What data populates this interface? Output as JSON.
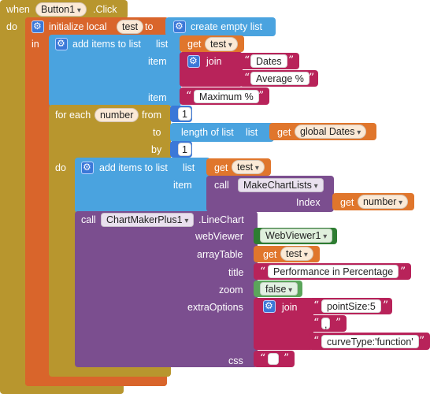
{
  "event": {
    "when": "when",
    "component": "Button1",
    "event_name": ".Click",
    "do": "do"
  },
  "init_local": {
    "label": "initialize local",
    "var": "test",
    "to": "to",
    "value": "create empty list",
    "in": "in"
  },
  "add1": {
    "label": "add items to list",
    "list_label": "list",
    "get": "get",
    "get_var": "test",
    "item_label": "item",
    "join": "join",
    "str1": "Dates",
    "str2": "Average %",
    "item2_label": "item",
    "str3": "Maximum %"
  },
  "foreach": {
    "label": "for each",
    "var": "number",
    "from": "from",
    "from_val": "1",
    "to": "to",
    "length_label": "length of list",
    "list_label": "list",
    "get": "get",
    "get_var": "global Dates",
    "by": "by",
    "by_val": "1",
    "do": "do"
  },
  "add2": {
    "label": "add items to list",
    "list_label": "list",
    "get": "get",
    "get_var": "test",
    "item_label": "item",
    "call": "call",
    "proc": "MakeChartLists",
    "index": "Index",
    "get2": "get",
    "get2_var": "number"
  },
  "linechart": {
    "call": "call",
    "component": "ChartMakerPlus1",
    "method": ".LineChart",
    "webviewer_label": "webViewer",
    "webviewer": "WebViewer1",
    "arraytable_label": "arrayTable",
    "get": "get",
    "get_var": "test",
    "title_label": "title",
    "title": "Performance in Percentage",
    "zoom_label": "zoom",
    "zoom": "false",
    "extra_label": "extraOptions",
    "join": "join",
    "opt1": "pointSize:5",
    "opt2": ",",
    "opt3": "curveType:'function'",
    "css_label": "css",
    "css": " "
  },
  "colors": {
    "event": "#b8962e",
    "local": "#d9652b",
    "list": "#4aa3df",
    "text": "#b8235a",
    "component": "#7b4e8f",
    "logic": "#5ba55b",
    "math": "#3b78d8"
  }
}
